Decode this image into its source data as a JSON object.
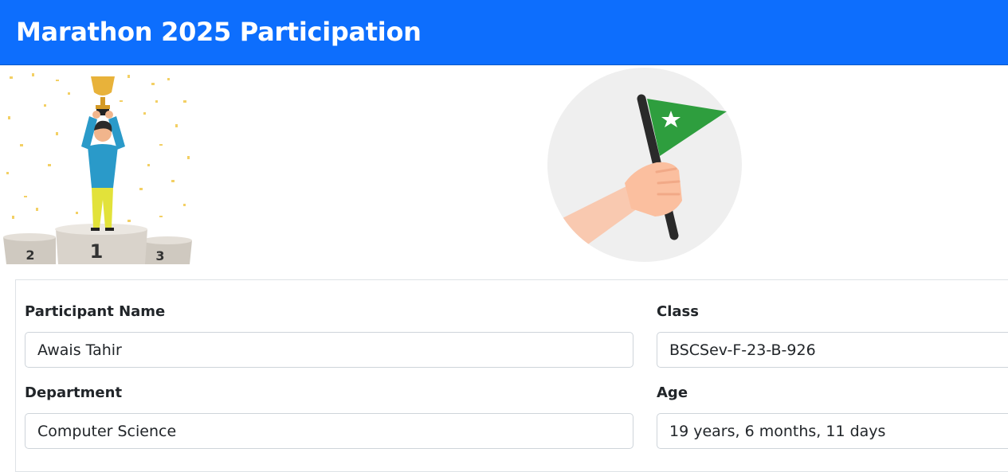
{
  "header": {
    "title": "Marathon 2025 Participation"
  },
  "illustrations": {
    "winner": {
      "icon": "winner-podium-icon",
      "podium_labels": [
        "2",
        "1",
        "3"
      ]
    },
    "flag": {
      "icon": "hand-holding-flag-icon",
      "flag_color": "#2e9e3e"
    }
  },
  "form": {
    "participant_name": {
      "label": "Participant Name",
      "value": "Awais Tahir"
    },
    "class": {
      "label": "Class",
      "value": "BSCSev-F-23-B-926"
    },
    "department": {
      "label": "Department",
      "value": "Computer Science"
    },
    "age": {
      "label": "Age",
      "value": "19 years, 6 months, 11 days"
    }
  },
  "colors": {
    "header_bg": "#0d6efd",
    "accent_green": "#2e9e3e",
    "trophy_gold": "#e8b23a"
  }
}
